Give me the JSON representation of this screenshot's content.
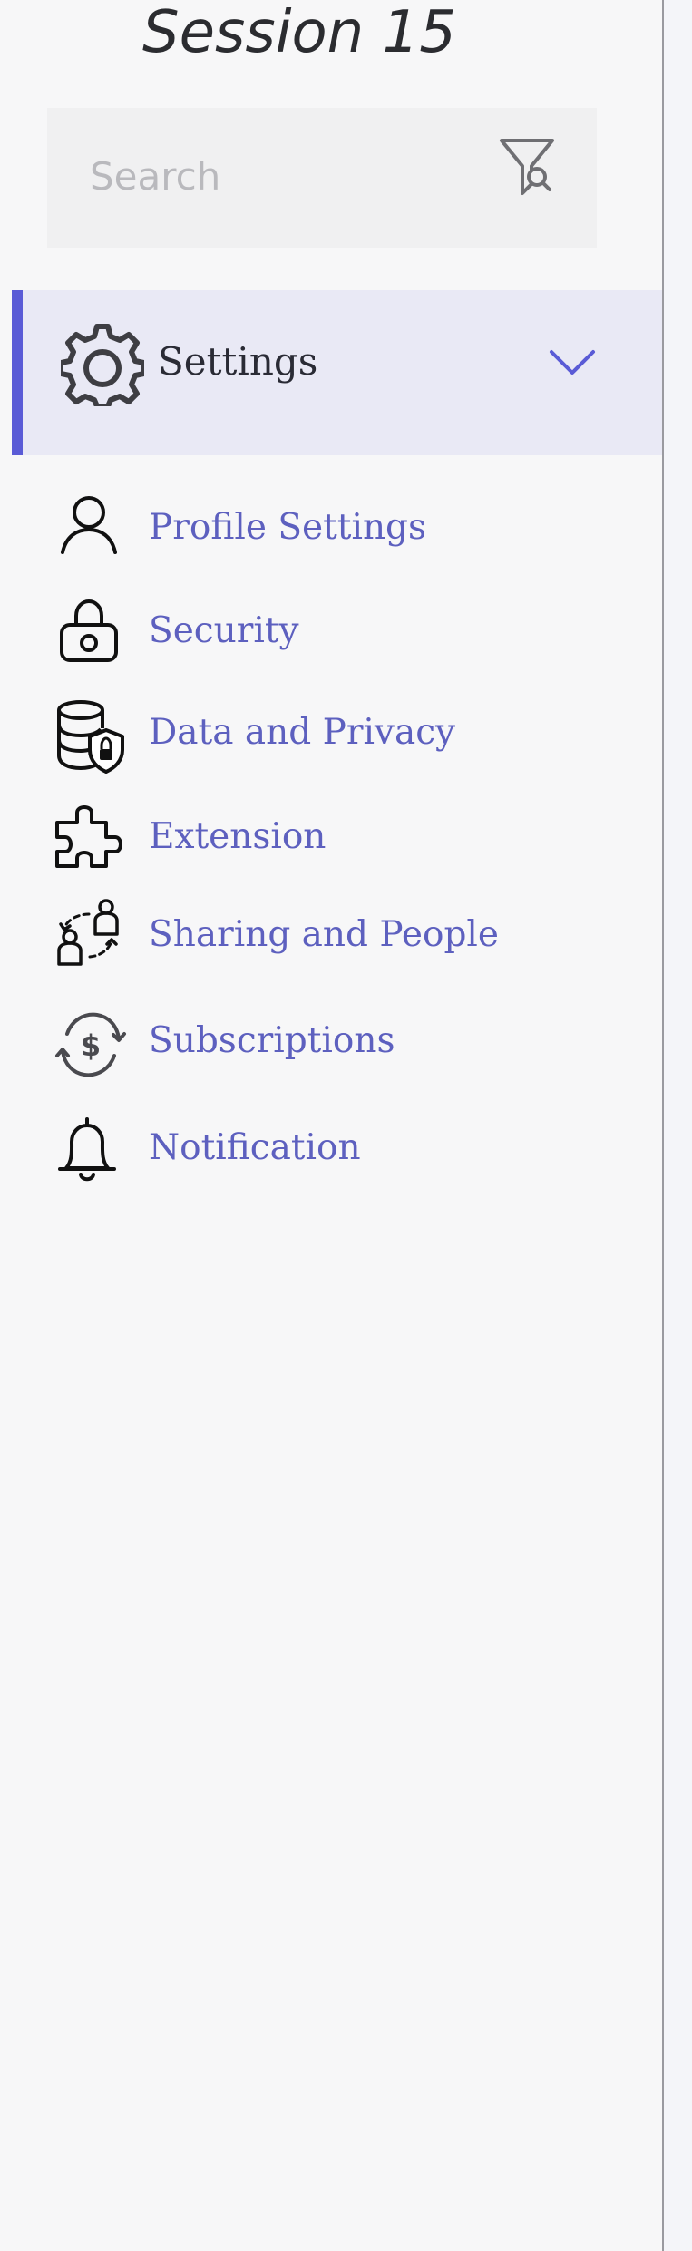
{
  "header": {
    "title": "Session 15"
  },
  "search": {
    "placeholder": "Search",
    "icon": "filter-search-icon"
  },
  "settings": {
    "label": "Settings",
    "icon": "gear-icon",
    "expanded": true,
    "accent_color": "#5a5bd6",
    "background_color": "#e9e9f5"
  },
  "menu": {
    "items": [
      {
        "label": "Profile Settings",
        "icon": "person-icon"
      },
      {
        "label": "Security",
        "icon": "lock-icon"
      },
      {
        "label": "Data and Privacy",
        "icon": "database-shield-icon"
      },
      {
        "label": "Extension",
        "icon": "puzzle-icon"
      },
      {
        "label": "Sharing and People",
        "icon": "sharing-people-icon"
      },
      {
        "label": "Subscriptions",
        "icon": "subscription-cycle-icon"
      },
      {
        "label": "Notification",
        "icon": "bell-icon"
      }
    ],
    "label_color": "#5d60bf"
  }
}
